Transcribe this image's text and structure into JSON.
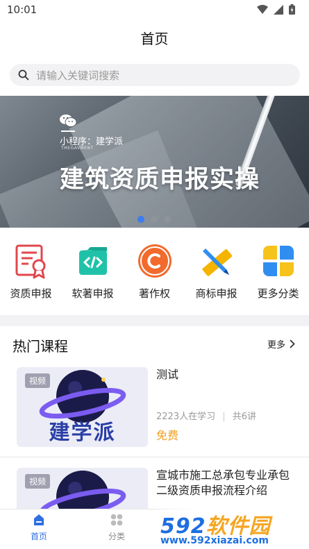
{
  "status_bar": {
    "time": "10:01"
  },
  "header": {
    "title": "首页"
  },
  "search": {
    "placeholder": "请输入关键词搜索"
  },
  "banner": {
    "subtitle": "小程序：建学派",
    "sublabel": "THEGAVMENT",
    "title": "建筑资质申报实操",
    "slide_count": 3,
    "active_slide": 1
  },
  "quick_menu": [
    {
      "label": "资质申报",
      "icon": "certificate-icon"
    },
    {
      "label": "软著申报",
      "icon": "code-folder-icon"
    },
    {
      "label": "著作权",
      "icon": "copyright-icon"
    },
    {
      "label": "商标申报",
      "icon": "ruler-pencil-icon"
    },
    {
      "label": "更多分类",
      "icon": "more-grid-icon"
    }
  ],
  "courses_section": {
    "title": "热门课程",
    "more_label": "更多",
    "items": [
      {
        "badge": "视频",
        "brand": "建学派",
        "title": "测试",
        "learners": "2223人在学习",
        "lessons": "共6讲",
        "price": "免费"
      },
      {
        "badge": "视频",
        "title": "宣城市施工总承包专业承包二级资质申报流程介绍"
      }
    ]
  },
  "tabbar": {
    "items": [
      {
        "label": "首页",
        "active": true
      },
      {
        "label": "分类",
        "active": false
      }
    ]
  },
  "watermark": {
    "brand_num": "592",
    "brand_text": "软件园",
    "url": "www.592xiazai.com"
  },
  "colors": {
    "accent": "#3b7df0",
    "price": "#f0a020",
    "menu_red": "#e0474c",
    "menu_teal": "#1fc2a8",
    "menu_orange": "#f26a2c",
    "menu_blue": "#2f8ef0"
  }
}
